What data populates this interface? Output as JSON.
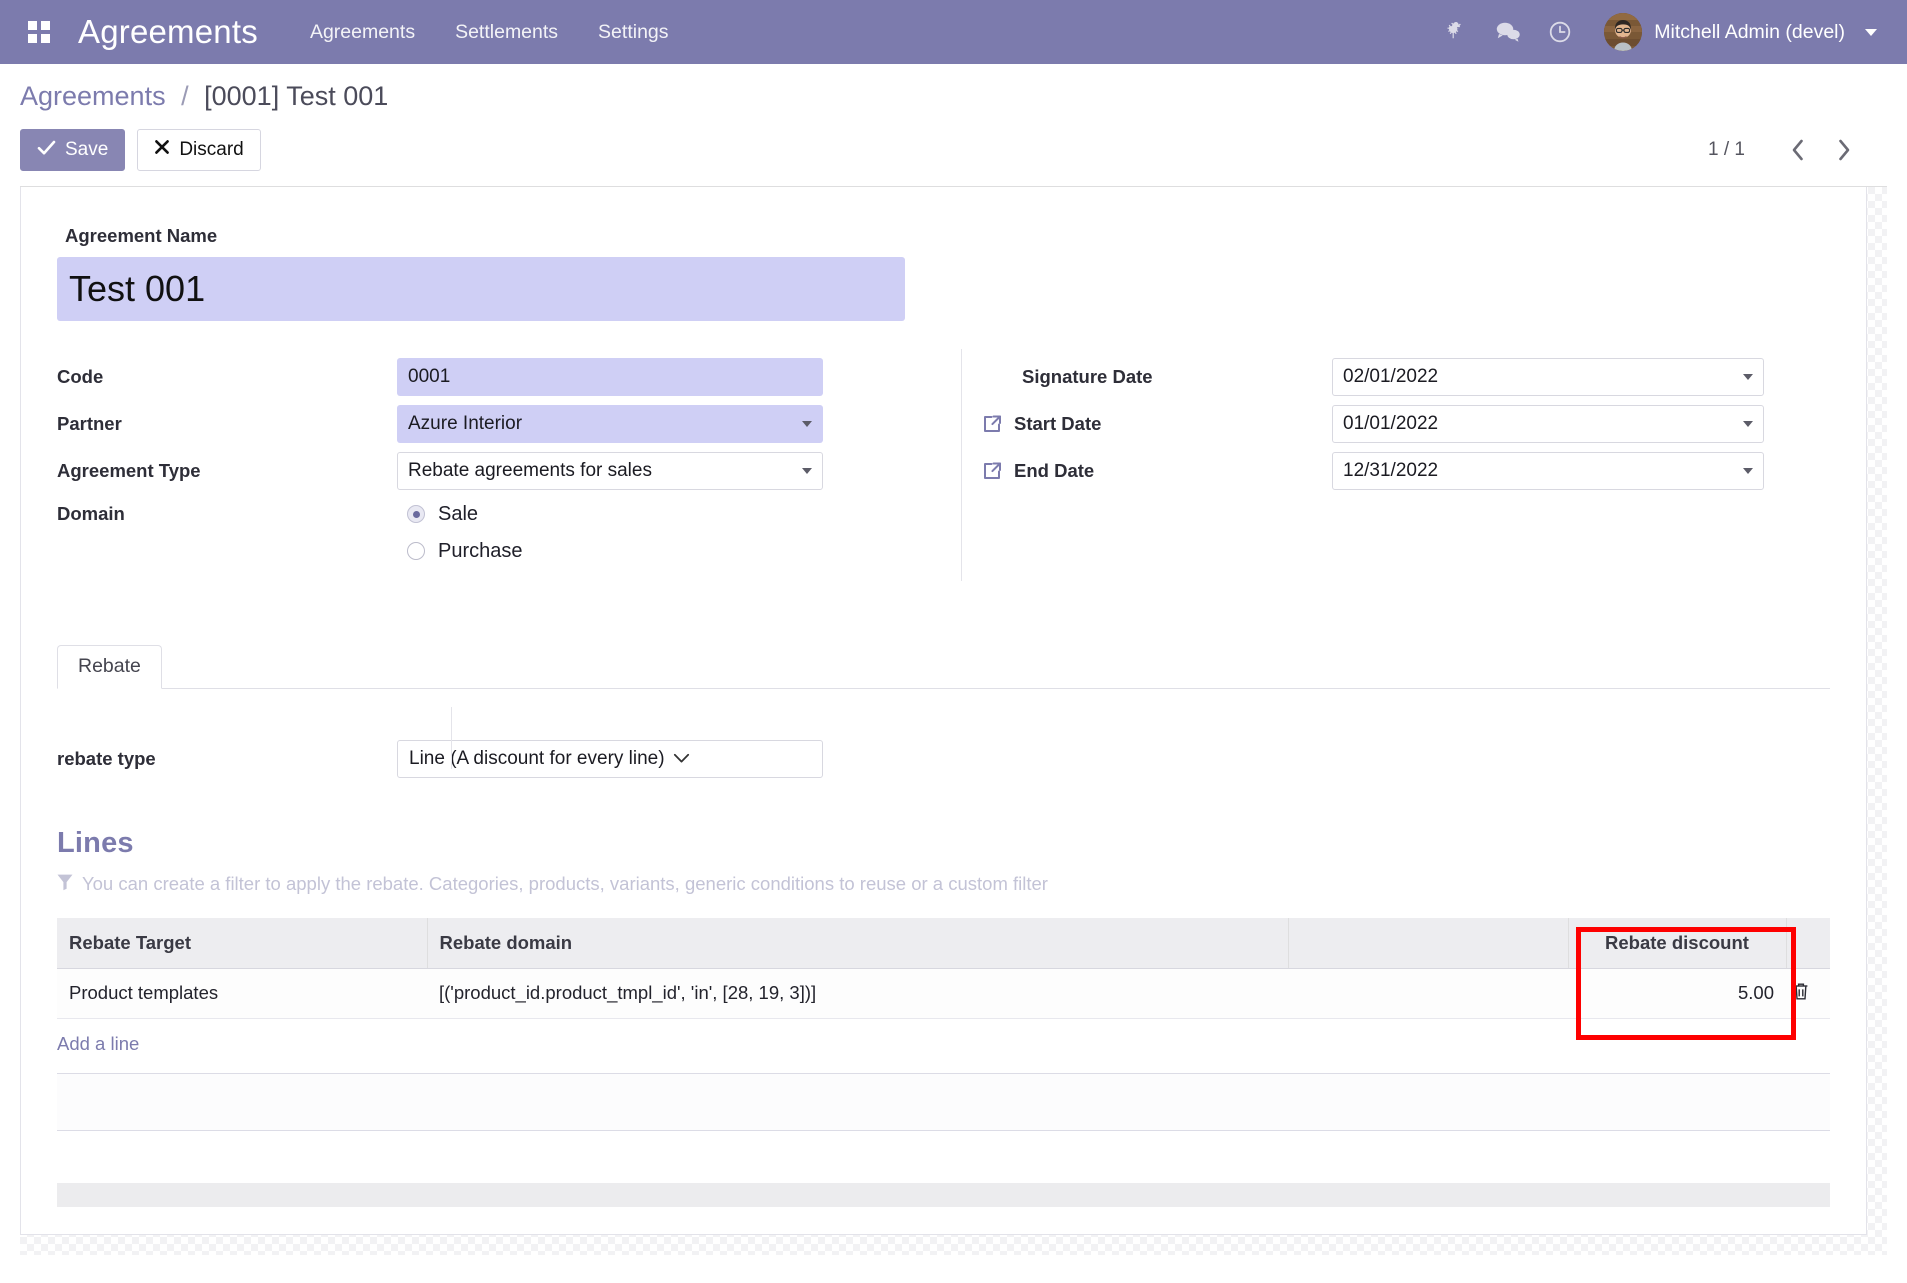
{
  "navbar": {
    "apps_icon": "apps-grid-icon",
    "brand": "Agreements",
    "menu": [
      {
        "label": "Agreements"
      },
      {
        "label": "Settlements"
      },
      {
        "label": "Settings"
      }
    ],
    "icons": [
      {
        "name": "debug-bug-icon",
        "glyph": "bug"
      },
      {
        "name": "messages-icon",
        "glyph": "comments"
      },
      {
        "name": "activities-clock-icon",
        "glyph": "clock"
      }
    ],
    "user": {
      "name": "Mitchell Admin (devel)",
      "avatar": "user-avatar"
    },
    "background_color": "#7c7bad"
  },
  "control_panel": {
    "breadcrumb": {
      "root": "Agreements",
      "separator": "/",
      "current": "[0001] Test 001"
    },
    "save_label": "Save",
    "discard_label": "Discard",
    "pager": {
      "count": "1 / 1",
      "prev": "‹",
      "next": "›"
    }
  },
  "form": {
    "title_label": "Agreement Name",
    "title_value": "Test 001",
    "left_fields": [
      {
        "label": "Code",
        "value": "0001",
        "widget": "text",
        "style": "filled"
      },
      {
        "label": "Partner",
        "value": "Azure Interior",
        "widget": "many2one",
        "style": "filled"
      },
      {
        "label": "Agreement Type",
        "value": "Rebate agreements for sales",
        "widget": "many2one",
        "style": "plain"
      }
    ],
    "domain": {
      "label": "Domain",
      "options": [
        {
          "label": "Sale",
          "selected": true
        },
        {
          "label": "Purchase",
          "selected": false
        }
      ]
    },
    "right_fields": [
      {
        "label": "Signature Date",
        "value": "02/01/2022",
        "has_link_icon": false
      },
      {
        "label": "Start Date",
        "value": "01/01/2022",
        "has_link_icon": true
      },
      {
        "label": "End Date",
        "value": "12/31/2022",
        "has_link_icon": true
      }
    ]
  },
  "notebook": {
    "tabs": [
      {
        "label": "Rebate",
        "active": true
      }
    ],
    "rebate_type": {
      "label": "rebate type",
      "value": "Line (A discount for every line)"
    }
  },
  "lines": {
    "title": "Lines",
    "hint": "You can create a filter to apply the rebate. Categories, products, variants, generic conditions to reuse or a custom filter",
    "columns": [
      "Rebate Target",
      "Rebate domain",
      "",
      "Rebate discount"
    ],
    "rows": [
      {
        "rebate_target": "Product templates",
        "rebate_domain": "[('product_id.product_tmpl_id', 'in', [28, 19, 3])]",
        "blank": "",
        "rebate_discount": "5.00",
        "delete_icon": "trash-icon"
      }
    ],
    "add_line_label": "Add a line"
  },
  "annotation": {
    "highlight_color": "#fe0000",
    "target": "rebate-discount-column"
  }
}
